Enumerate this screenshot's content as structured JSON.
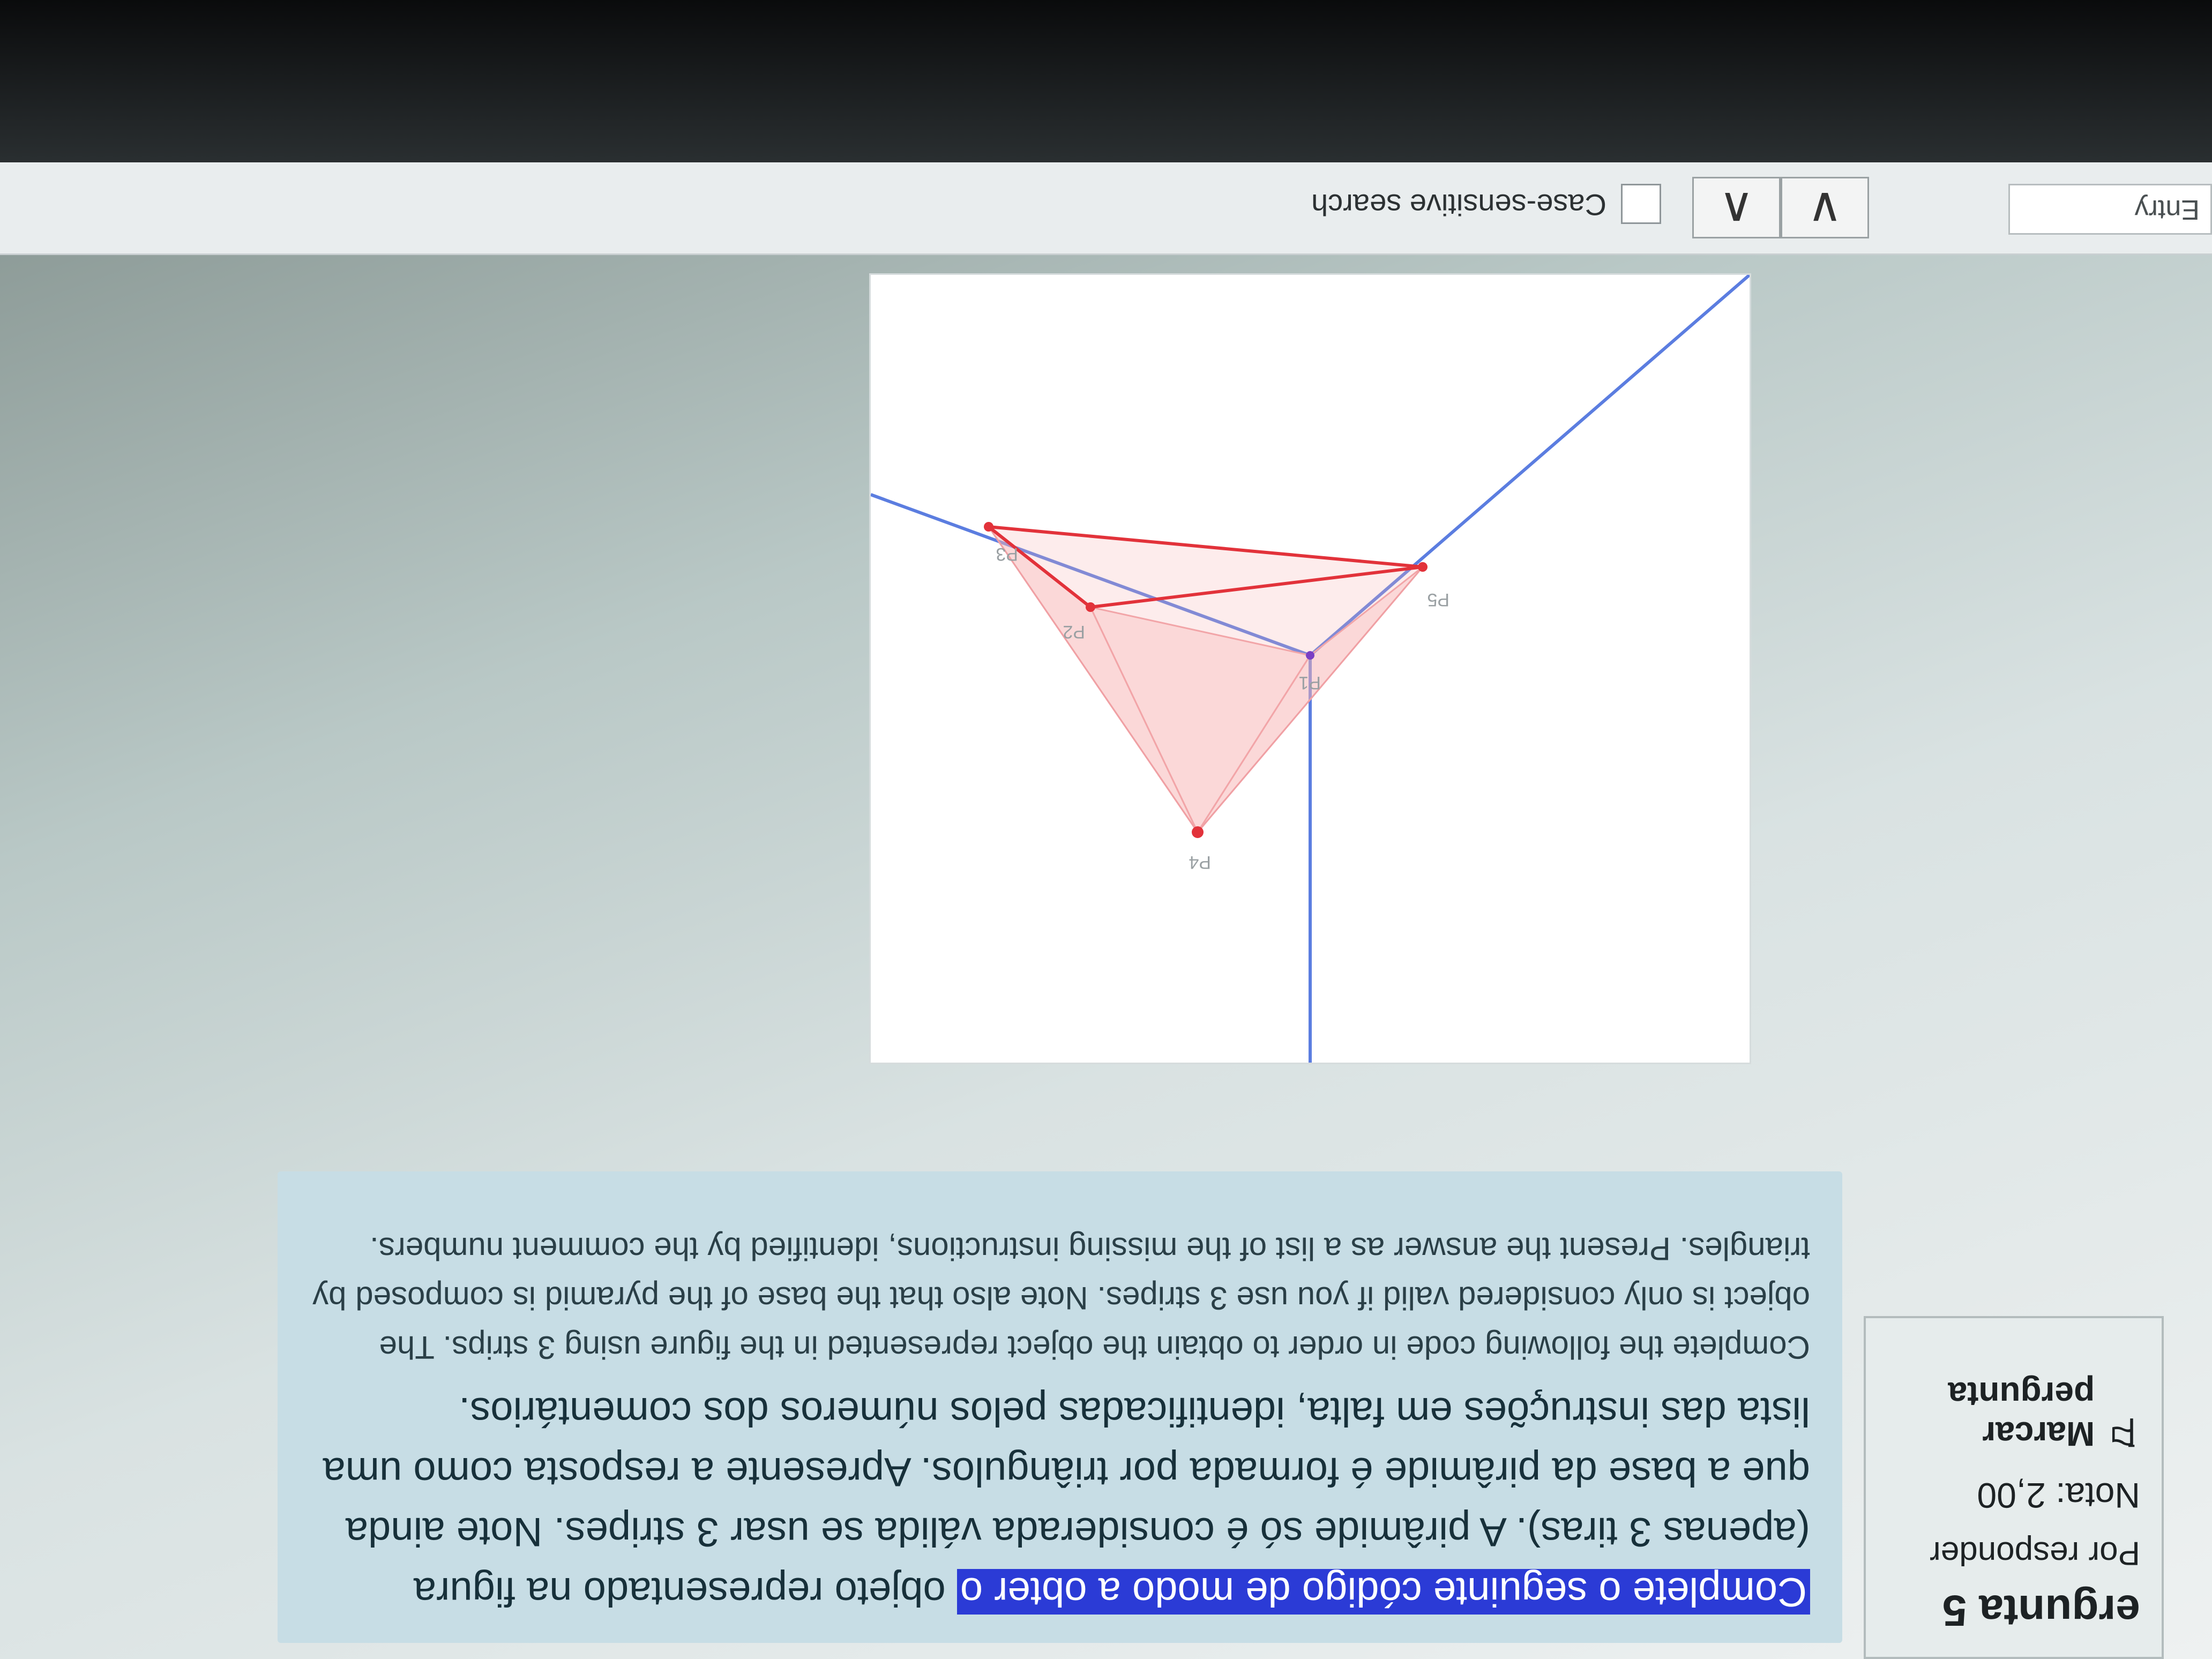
{
  "info": {
    "title": "ergunta 5",
    "status": "Por responder",
    "grade": "Nota: 2,00",
    "flag_label": "Marcar pergunta",
    "flag_icon": "flag-icon"
  },
  "question": {
    "highlighted": "Complete o seguinte código de modo a obter o",
    "text_pt": "objeto representado na figura (apenas 3 tiras). A pirâmide só é considerada válida se usar 3 stripes. Note ainda que a base da pirâmide é formada por triângulos. Apresente a resposta como uma lista das instruções em falta, identificadas pelos números dos comentários.",
    "text_en": "Complete the following code in order to obtain the object represented in the figure using 3 strips. The object is only considered valid if you use 3 stripes. Note also that the base of the pyramid is composed by triangles. Present the answer as a list of the missing instructions, identified by the comment numbers."
  },
  "figure": {
    "labels": [
      "P1",
      "P2",
      "P3",
      "P4",
      "P5"
    ],
    "colors": {
      "axis": "#5b7de0",
      "edge": "#e2323a",
      "fill": "#f6b3b5"
    }
  },
  "findbar": {
    "input_value": "Entry",
    "prev_label": "∨",
    "next_label": "∧",
    "checkbox_label": "Case-sensitive search"
  }
}
